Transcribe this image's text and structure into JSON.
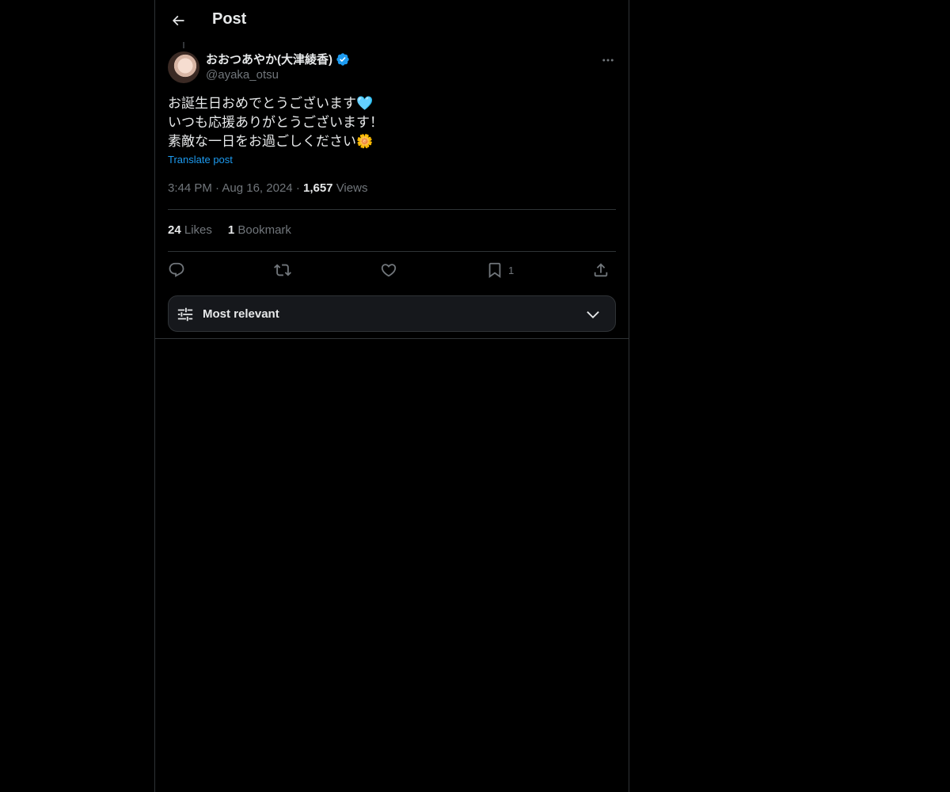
{
  "header": {
    "title": "Post"
  },
  "post": {
    "author_name": "おおつあやか(大津綾香)",
    "handle": "@ayaka_otsu",
    "verified": true,
    "lines": [
      "お誕生日おめでとうございます🩵",
      "いつも応援ありがとうございます！",
      "素敵な一日をお過ごしください🌼"
    ],
    "translate_label": "Translate post",
    "time": "3:44 PM",
    "date": "Aug 16, 2024",
    "views_count": "1,657",
    "views_label": "Views",
    "dot": "·"
  },
  "stats": {
    "likes_count": "24",
    "likes_label": "Likes",
    "bookmarks_count": "1",
    "bookmarks_label": "Bookmark"
  },
  "actions": {
    "bookmark_count": "1"
  },
  "sort": {
    "label": "Most relevant"
  },
  "colors": {
    "background": "#000000",
    "text": "#e7e9ea",
    "muted": "#71767b",
    "accent": "#1d9bf0",
    "border": "#2f3336"
  }
}
